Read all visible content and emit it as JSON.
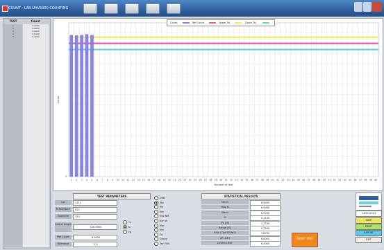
{
  "window": {
    "title": "COUNT - LAB UHV5000 COUNTING"
  },
  "left_panel": {
    "headers": {
      "test": "TEST",
      "count": "Count"
    },
    "rows": [
      {
        "test": "1",
        "count": "6.9000"
      },
      {
        "test": "2",
        "count": "6.8800"
      },
      {
        "test": "3",
        "count": "6.9000"
      },
      {
        "test": "4",
        "count": "6.9400"
      },
      {
        "test": "5",
        "count": "6.9000"
      }
    ]
  },
  "chart": {
    "legend": {
      "count": "Count",
      "ref_count": "Ref Count",
      "upper_tol": "Upper Tol",
      "down_tol": "Down Tol"
    },
    "ylabel": "Count",
    "xlabel": "Number of test"
  },
  "chart_data": {
    "type": "bar",
    "title": "",
    "xlabel": "Number of test",
    "ylabel": "Count",
    "ylim": [
      0,
      7.5
    ],
    "categories": [
      "1",
      "2",
      "3",
      "4",
      "5",
      "6",
      "7",
      "8",
      "9",
      "10",
      "11",
      "12",
      "13",
      "14",
      "15",
      "16",
      "17",
      "18",
      "19",
      "20",
      "21",
      "22",
      "23",
      "24",
      "25",
      "26",
      "27",
      "28",
      "29",
      "30",
      "31",
      "32",
      "33",
      "34",
      "35",
      "36",
      "37",
      "38",
      "39",
      "40",
      "41",
      "42",
      "43",
      "44",
      "45",
      "46",
      "47",
      "48",
      "49",
      "50",
      "51",
      "52",
      "53",
      "54",
      "55",
      "56",
      "57",
      "58",
      "59",
      "60"
    ],
    "series": [
      {
        "name": "Count",
        "values": [
          6.9,
          6.88,
          6.9,
          6.94,
          6.9
        ]
      }
    ],
    "reference_lines": [
      {
        "name": "Ref Count",
        "value": 6.5,
        "color": "#e05ab8"
      },
      {
        "name": "Upper Tol",
        "value": 6.8,
        "color": "#f0ee5a"
      },
      {
        "name": "Down Tol",
        "value": 6.2,
        "color": "#6ad0e8"
      }
    ],
    "bar_color": "#8a86e0",
    "grid": true
  },
  "test_params": {
    "heading": "TEST PARAMETERS",
    "lot_label": "Lot",
    "lot_value": "1111",
    "pallet_label": "Pallet/Batch",
    "pallet_value": "222",
    "examiner_label": "Examiner",
    "examiner_value": "333",
    "length_label": "Unit of length",
    "length_value": "100.0000",
    "ref_count_label": "Ref Count",
    "ref_count_value": "6.0000",
    "tolerance_label": "Tolerance",
    "tolerance_value": "5.5",
    "unit_options": [
      "%",
      "N",
      "kg"
    ],
    "unit_selected": "N"
  },
  "yarn_options": {
    "items": [
      "Dtex",
      "Tex",
      "Ne",
      "Nm",
      "Nec NM",
      "den tk",
      "Nwr",
      "Nm",
      "Td",
      "Denier",
      "Tex ESN"
    ],
    "selected": "Tex"
  },
  "stats": {
    "heading": "STATISTICAL RESULTS",
    "rows": [
      {
        "label": "Min N",
        "value": "6.9000"
      },
      {
        "label": "Max N",
        "value": "6.9000"
      },
      {
        "label": "Mean",
        "value": "6.9200"
      },
      {
        "label": "S",
        "value": "0.2100"
      },
      {
        "label": "CV [%]",
        "value": "1.3750"
      },
      {
        "label": "Range [%]",
        "value": "0.7500"
      },
      {
        "label": "95% CONFIDENCE",
        "value": "1.8750"
      },
      {
        "label": "UP LIMIT",
        "value": "6.8000"
      },
      {
        "label": "DOWN LIMIT",
        "value": "6.4000"
      }
    ]
  },
  "buttons": {
    "reset": "RESET TEST",
    "date": "14/01/2013",
    "b1": "SAVE",
    "b2": "PRINT",
    "b3": "EXPORT",
    "b4": "EXIT"
  },
  "colors": {
    "accent": "#2e5f9e",
    "reset": "#f0861c"
  }
}
